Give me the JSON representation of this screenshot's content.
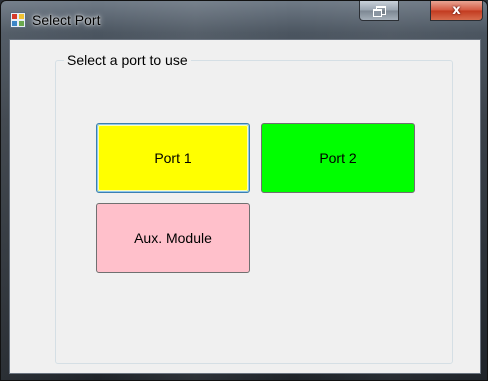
{
  "window": {
    "title": "Select Port",
    "icons": {
      "app": "app-window-icon",
      "restore": "restore-icon",
      "close": "close-icon"
    },
    "close_glyph": "x"
  },
  "group": {
    "caption": "Select a port to use"
  },
  "buttons": {
    "port1": {
      "label": "Port 1",
      "color": "#ffff00"
    },
    "port2": {
      "label": "Port 2",
      "color": "#00ff00"
    },
    "aux": {
      "label": "Aux. Module",
      "color": "#ffc0cb"
    }
  }
}
